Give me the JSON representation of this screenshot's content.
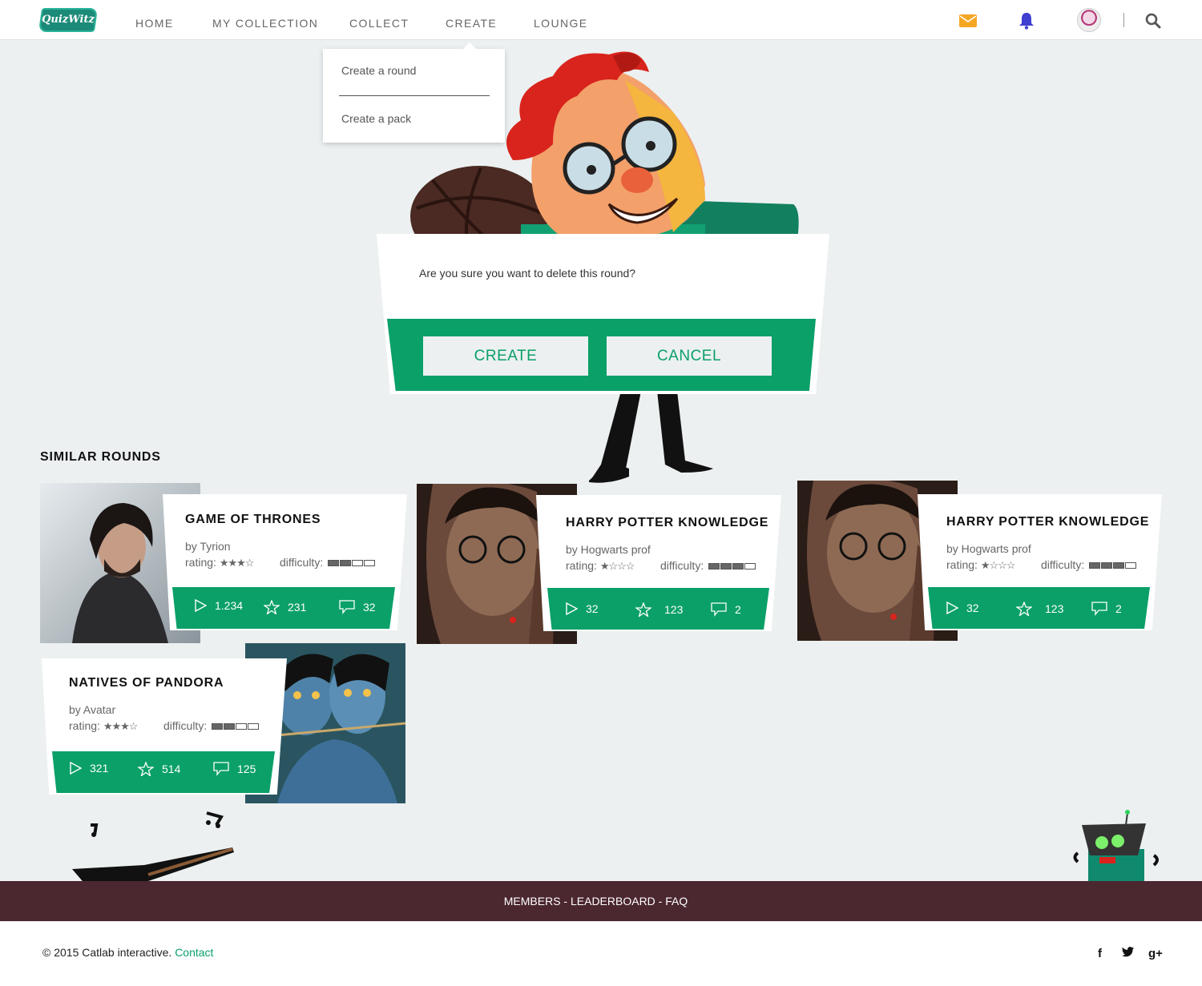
{
  "brand": {
    "logo_text": "QuizWitz"
  },
  "nav": {
    "items": [
      {
        "label": "HOME"
      },
      {
        "label": "MY COLLECTION"
      },
      {
        "label": "COLLECT"
      },
      {
        "label": "CREATE"
      },
      {
        "label": "LOUNGE"
      }
    ],
    "icons": [
      "mail-icon",
      "bell-icon",
      "avatar",
      "search-icon"
    ],
    "accent_mail": "#f5a623",
    "accent_bell": "#3f3fd0"
  },
  "dropdown": {
    "items": [
      {
        "label": "Create a round"
      },
      {
        "label": "Create a pack"
      }
    ]
  },
  "modal": {
    "message": "Are you sure you want to delete this round?",
    "primary_label": "CREATE",
    "secondary_label": "CANCEL"
  },
  "similar": {
    "title": "SIMILAR ROUNDS",
    "cards": [
      {
        "title": "GAME OF THRONES",
        "by": "by Tyrion",
        "rating_label": "rating:",
        "rating": 3,
        "rating_max": 4,
        "difficulty_label": "difficulty:",
        "difficulty": 2,
        "difficulty_max": 4,
        "plays": "1.234",
        "favorites": "231",
        "comments": "32"
      },
      {
        "title": "HARRY POTTER KNOWLEDGE",
        "by": "by Hogwarts prof",
        "rating_label": "rating:",
        "rating": 1,
        "rating_max": 4,
        "difficulty_label": "difficulty:",
        "difficulty": 3,
        "difficulty_max": 4,
        "plays": "32",
        "favorites": "123",
        "comments": "2"
      },
      {
        "title": "HARRY POTTER KNOWLEDGE",
        "by": "by Hogwarts prof",
        "rating_label": "rating:",
        "rating": 1,
        "rating_max": 4,
        "difficulty_label": "difficulty:",
        "difficulty": 3,
        "difficulty_max": 4,
        "plays": "32",
        "favorites": "123",
        "comments": "2"
      },
      {
        "title": "NATIVES OF PANDORA",
        "by": "by Avatar",
        "rating_label": "rating:",
        "rating": 3,
        "rating_max": 4,
        "difficulty_label": "difficulty:",
        "difficulty": 2,
        "difficulty_max": 4,
        "plays": "321",
        "favorites": "514",
        "comments": "125"
      }
    ]
  },
  "footer": {
    "links": "MEMBERS - LEADERBOARD - FAQ",
    "copyright": "© 2015 Catlab interactive.",
    "contact": "Contact",
    "social": [
      "f",
      "t",
      "g+"
    ]
  },
  "colors": {
    "green": "#0aa068",
    "footer": "#4b2730",
    "background": "#ecf0f1"
  }
}
